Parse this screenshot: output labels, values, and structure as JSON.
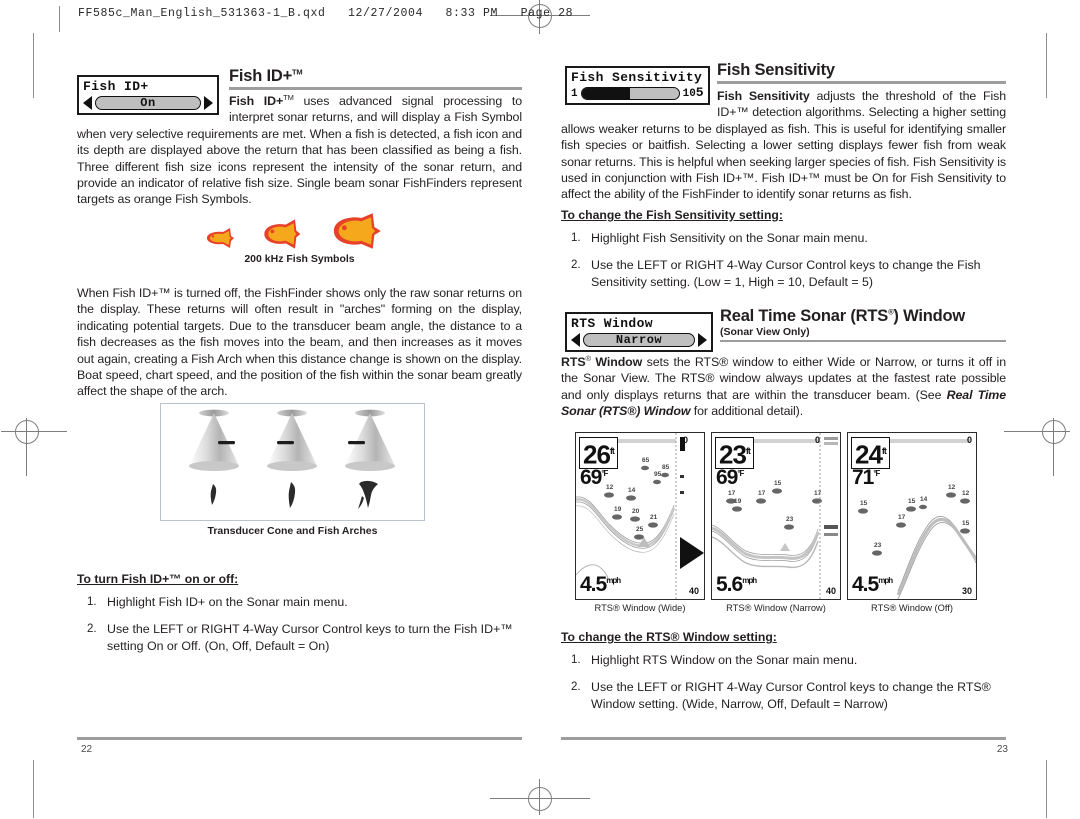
{
  "header": {
    "file_line": "FF585c_Man_English_531363-1_B.qxd   12/27/2004   8:33 PM   Page 28"
  },
  "left_column": {
    "menu_widget": {
      "title": "Fish ID+",
      "value": "On",
      "left_arrow": "left-arrow",
      "right_arrow": "right-arrow"
    },
    "section_title": "Fish ID+",
    "section_title_tm": "TM",
    "paragraph_1_lead": "Fish ID+",
    "paragraph_1": " uses advanced signal processing to interpret sonar returns, and will display a Fish Symbol when very selective requirements are met. When a fish is detected, a fish icon and its depth are displayed above the return that has been classified as being a fish.  Three different fish size icons represent  the intensity of the sonar return, and provide an indicator of relative fish size. Single beam sonar FishFinders represent targets as orange Fish Symbols.",
    "fish_figure_caption": "200 kHz Fish Symbols",
    "paragraph_2": "When Fish ID+™ is turned off, the FishFinder shows only the raw sonar returns on the display. These returns will often result in \"arches\" forming on the display, indicating potential targets. Due to the transducer beam angle, the distance to a fish decreases as the fish moves into the beam, and then increases as it moves out again, creating a Fish Arch when this distance change is shown on the display.  Boat speed, chart speed, and the position of the fish within the sonar beam greatly affect the shape of the arch.",
    "cone_figure_caption": "Transducer Cone and Fish Arches",
    "howto_title": "To turn Fish ID+™ on or off:",
    "steps": [
      {
        "num": "1.",
        "text": "Highlight Fish ID+ on the Sonar main menu."
      },
      {
        "num": "2.",
        "text": "Use the LEFT or RIGHT 4-Way Cursor Control keys to turn the Fish ID+™ setting On or Off. (On, Off, Default = On)"
      }
    ],
    "page_number": "22"
  },
  "right_column": {
    "sensitivity_widget": {
      "title": "Fish Sensitivity",
      "value": "5",
      "min_label": "1",
      "max_label": "10",
      "fill_percent": 50
    },
    "sensitivity_title": "Fish Sensitivity",
    "sensitivity_paragraph_lead": "Fish Sensitivity",
    "sensitivity_paragraph": " adjusts the threshold of the Fish ID+™ detection algorithms. Selecting a higher setting allows weaker returns to be displayed as fish. This is useful for identifying smaller fish species or baitfish. Selecting a lower setting displays fewer fish from weak sonar returns.  This is helpful when seeking larger species of fish. Fish Sensitivity is used in conjunction with Fish ID+™. Fish ID+™ must be On for Fish Sensitivity to affect the ability of the FishFinder to identify sonar returns as fish.",
    "sensitivity_howto": "To change the Fish Sensitivity setting:",
    "sensitivity_steps": [
      {
        "num": "1.",
        "text": "Highlight Fish Sensitivity on the Sonar main menu."
      },
      {
        "num": "2.",
        "text": "Use the LEFT or RIGHT 4-Way Cursor Control keys to change the Fish Sensitivity setting. (Low = 1, High = 10, Default = 5)"
      }
    ],
    "rts_widget": {
      "title": "RTS Window",
      "value": "Narrow"
    },
    "rts_title": "Real Time Sonar (RTS",
    "rts_title_reg": "®",
    "rts_title_end": ") Window",
    "rts_subtitle": "(Sonar View Only)",
    "rts_paragraph_lead": "RTS",
    "rts_paragraph": " sets the RTS® window to either Wide or Narrow, or turns it off in the Sonar View. The RTS® window always updates at the fastest rate possible and only displays returns that are within the transducer beam. (See ",
    "rts_paragraph_italic": "Real Time Sonar (RTS®) Window",
    "rts_paragraph_end": " for additional detail).",
    "rts_howto": "To change the RTS® Window setting:",
    "rts_steps": [
      {
        "num": "1.",
        "text": "Highlight RTS Window on the Sonar main menu."
      },
      {
        "num": "2.",
        "text": "Use the LEFT or RIGHT 4-Way Cursor Control keys to change the RTS® Window setting. (Wide, Narrow, Off, Default = Narrow)"
      }
    ],
    "page_number": "23"
  },
  "sonar_screens": [
    {
      "depth": "26",
      "depth_unit": "ft",
      "temp": "69",
      "temp_unit": "°F",
      "speed": "4.5",
      "speed_unit": "mph",
      "range_top": "0",
      "range_bottom": "40",
      "caption": "RTS® Window (Wide)",
      "rts_mode": "wide",
      "fish_depths": [
        "65",
        "85",
        "95",
        "12",
        "14",
        "19",
        "20",
        "21",
        "25"
      ]
    },
    {
      "depth": "23",
      "depth_unit": "ft",
      "temp": "69",
      "temp_unit": "°F",
      "speed": "5.6",
      "speed_unit": "mph",
      "range_top": "0",
      "range_bottom": "40",
      "caption": "RTS® Window (Narrow)",
      "rts_mode": "narrow",
      "fish_depths": [
        "15",
        "17",
        "17",
        "17",
        "19",
        "23"
      ]
    },
    {
      "depth": "24",
      "depth_unit": "ft",
      "temp": "71",
      "temp_unit": "°F",
      "speed": "4.5",
      "speed_unit": "mph",
      "range_top": "0",
      "range_bottom": "30",
      "caption": "RTS® Window (Off)",
      "rts_mode": "off",
      "fish_depths": [
        "12",
        "12",
        "15",
        "15",
        "14",
        "17",
        "15",
        "23"
      ]
    }
  ]
}
